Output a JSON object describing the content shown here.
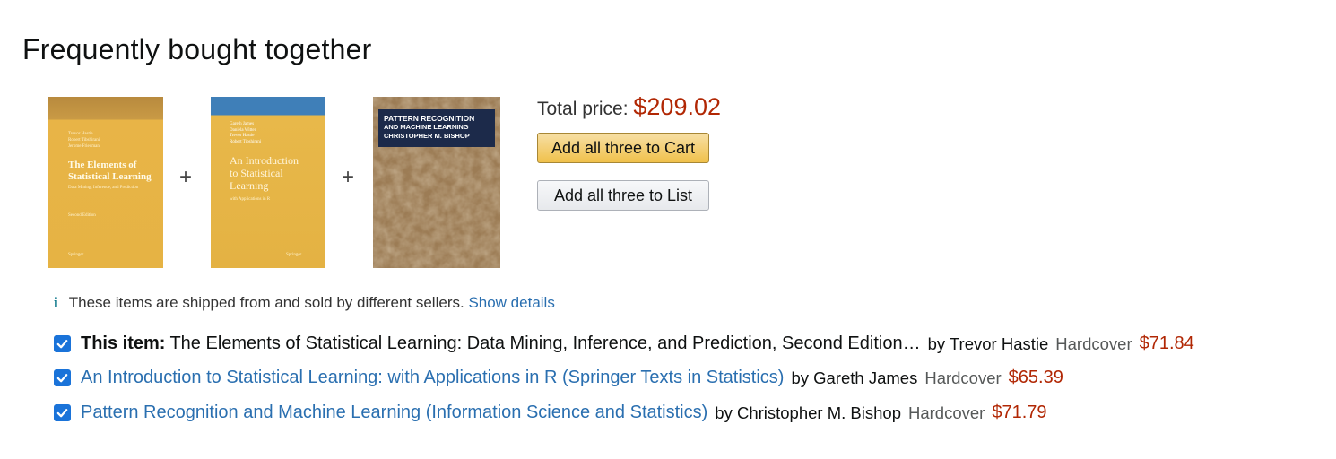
{
  "heading": "Frequently bought together",
  "covers": [
    {
      "authors": [
        "Trevor Hastie",
        "Robert Tibshirani",
        "Jerome Friedman"
      ],
      "title_lines": [
        "The Elements of",
        "Statistical Learning"
      ],
      "subtitle": "Data Mining, Inference, and Prediction",
      "edition": "Second Edition",
      "publisher": "Springer"
    },
    {
      "authors": [
        "Gareth James",
        "Daniela Witten",
        "Trevor Hastie",
        "Robert Tibshirani"
      ],
      "title_lines": [
        "An Introduction",
        "to Statistical",
        "Learning"
      ],
      "subtitle": "with Applications in R",
      "publisher": "Springer"
    },
    {
      "title_lines": [
        "PATTERN RECOGNITION",
        "AND MACHINE LEARNING"
      ],
      "author": "CHRISTOPHER M. BISHOP"
    }
  ],
  "plus_sign": "+",
  "summary": {
    "total_label": "Total price:",
    "total_price": "$209.02",
    "add_to_cart_label": "Add all three to Cart",
    "add_to_list_label": "Add all three to List"
  },
  "info": {
    "icon": "i",
    "text": "These items are shipped from and sold by different sellers.",
    "link": "Show details"
  },
  "items": [
    {
      "prefix": "This item:",
      "title": "The Elements of Statistical Learning: Data Mining, Inference, and Prediction, Second Edition…",
      "by": "by Trevor Hastie",
      "format": "Hardcover",
      "price": "$71.84",
      "checked": true
    },
    {
      "title": "An Introduction to Statistical Learning: with Applications in R (Springer Texts in Statistics)",
      "by": "by Gareth James",
      "format": "Hardcover",
      "price": "$65.39",
      "checked": true
    },
    {
      "title": "Pattern Recognition and Machine Learning (Information Science and Statistics)",
      "by": "by Christopher M. Bishop",
      "format": "Hardcover",
      "price": "$71.79",
      "checked": true
    }
  ],
  "colors": {
    "price": "#b12704",
    "link": "#2a6fb0",
    "checkbox": "#1a73d9",
    "cart_button": "#f0c14b"
  }
}
